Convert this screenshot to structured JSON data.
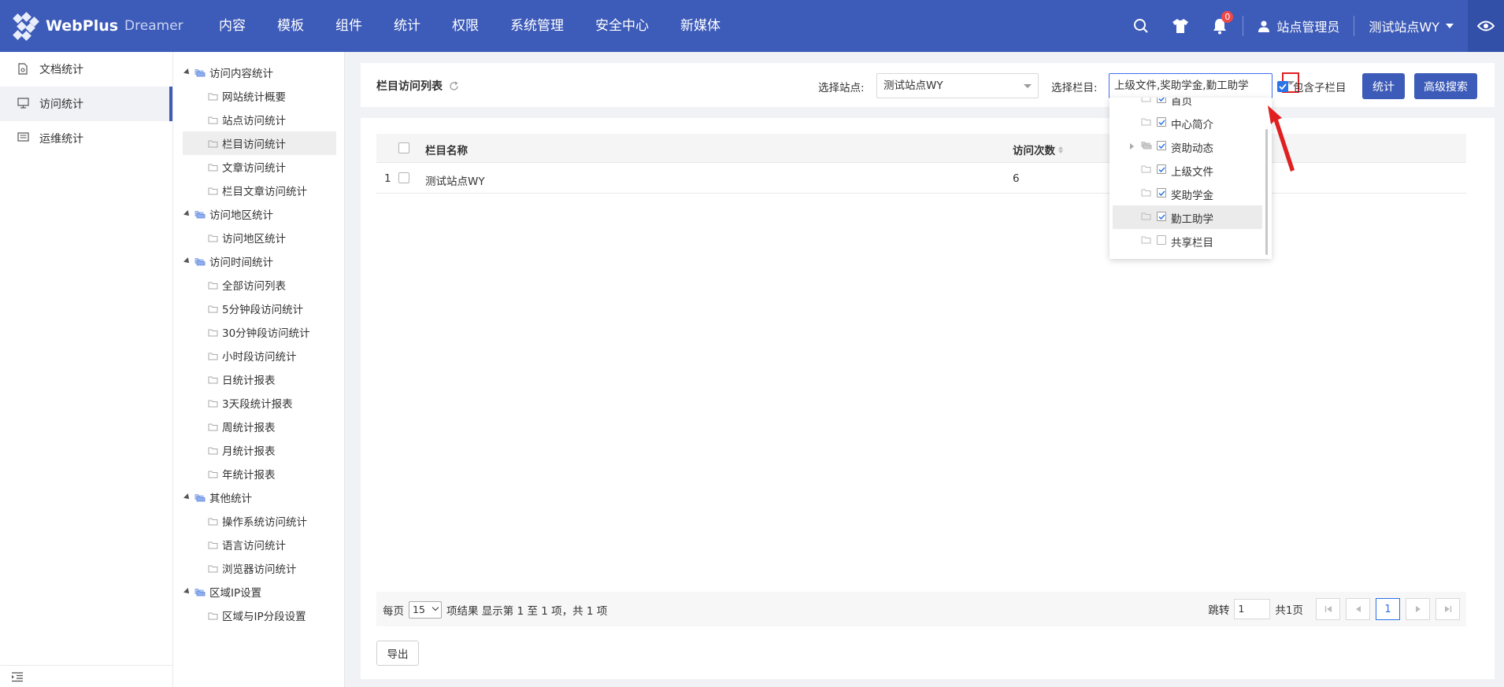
{
  "brand": {
    "name": "WebPlus",
    "sub": "Dreamer"
  },
  "topnav": [
    "内容",
    "模板",
    "组件",
    "统计",
    "权限",
    "系统管理",
    "安全中心",
    "新媒体"
  ],
  "header": {
    "notifications": "0",
    "user": "站点管理员",
    "site": "测试站点WY"
  },
  "sidebar": [
    "文档统计",
    "访问统计",
    "运维统计"
  ],
  "tree": [
    {
      "label": "访问内容统计",
      "type": "parent"
    },
    {
      "label": "网站统计概要",
      "type": "child"
    },
    {
      "label": "站点访问统计",
      "type": "child"
    },
    {
      "label": "栏目访问统计",
      "type": "child",
      "selected": true
    },
    {
      "label": "文章访问统计",
      "type": "child"
    },
    {
      "label": "栏目文章访问统计",
      "type": "child"
    },
    {
      "label": "访问地区统计",
      "type": "parent"
    },
    {
      "label": "访问地区统计",
      "type": "child"
    },
    {
      "label": "访问时间统计",
      "type": "parent"
    },
    {
      "label": "全部访问列表",
      "type": "child"
    },
    {
      "label": "5分钟段访问统计",
      "type": "child"
    },
    {
      "label": "30分钟段访问统计",
      "type": "child"
    },
    {
      "label": "小时段访问统计",
      "type": "child"
    },
    {
      "label": "日统计报表",
      "type": "child"
    },
    {
      "label": "3天段统计报表",
      "type": "child"
    },
    {
      "label": "周统计报表",
      "type": "child"
    },
    {
      "label": "月统计报表",
      "type": "child"
    },
    {
      "label": "年统计报表",
      "type": "child"
    },
    {
      "label": "其他统计",
      "type": "parent"
    },
    {
      "label": "操作系统访问统计",
      "type": "child"
    },
    {
      "label": "语言访问统计",
      "type": "child"
    },
    {
      "label": "浏览器访问统计",
      "type": "child"
    },
    {
      "label": "区域IP设置",
      "type": "parent"
    },
    {
      "label": "区域与IP分段设置",
      "type": "child"
    }
  ],
  "panel": {
    "title": "栏目访问列表",
    "site_label": "选择站点:",
    "site_value": "测试站点WY",
    "column_label": "选择栏目:",
    "column_value": "上级文件,奖助学金,勤工助学",
    "include_label": "包含子栏目",
    "include_checked": true,
    "stat_button": "统计",
    "adv_button": "高级搜索"
  },
  "table": {
    "columns": [
      "栏目名称",
      "访问次数"
    ],
    "rows": [
      {
        "index": "1",
        "name": "测试站点WY",
        "count": "6"
      }
    ]
  },
  "pager": {
    "per_page_label": "每页",
    "per_page": "15",
    "summary": "项结果 显示第 1 至 1 项，共 1 项",
    "jump_label": "跳转",
    "jump_value": "1",
    "total_pages": "共1页",
    "current": "1"
  },
  "export_button": "导出",
  "dropdown": [
    {
      "label": "首页",
      "checked": true,
      "expandable": false
    },
    {
      "label": "中心简介",
      "checked": true,
      "expandable": false
    },
    {
      "label": "资助动态",
      "checked": true,
      "expandable": true
    },
    {
      "label": "上级文件",
      "checked": true,
      "expandable": false
    },
    {
      "label": "奖助学金",
      "checked": true,
      "expandable": false
    },
    {
      "label": "勤工助学",
      "checked": true,
      "expandable": false,
      "highlighted": true
    },
    {
      "label": "共享栏目",
      "checked": false,
      "expandable": false
    }
  ],
  "colors": {
    "header": "#3d5bb8",
    "primary": "#3d5bb8",
    "accent": "#2a73e8",
    "annotation": "#e02020"
  }
}
